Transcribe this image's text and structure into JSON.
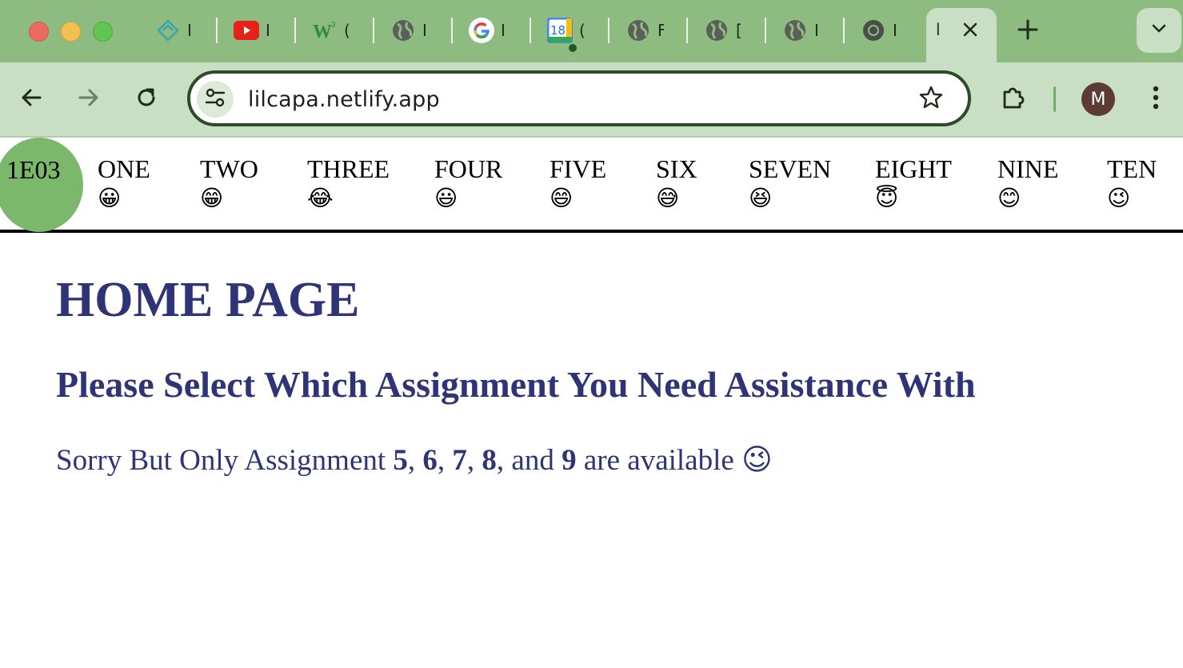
{
  "browser": {
    "tabs": [
      {
        "icon": "netlify-icon",
        "title": "I"
      },
      {
        "icon": "youtube-icon",
        "title": "I"
      },
      {
        "icon": "w3schools-icon",
        "title": "("
      },
      {
        "icon": "globe-icon",
        "title": "I"
      },
      {
        "icon": "google-icon",
        "title": "I"
      },
      {
        "icon": "calendar-icon",
        "title": "(",
        "calendar_day": "18"
      },
      {
        "icon": "globe-icon",
        "title": "F"
      },
      {
        "icon": "globe-icon",
        "title": "["
      },
      {
        "icon": "globe-icon",
        "title": "I"
      },
      {
        "icon": "chrome-icon",
        "title": "I"
      }
    ],
    "active_tab": {
      "title": "l"
    },
    "url": "lilcapa.netlify.app",
    "avatar_initial": "M",
    "colors": {
      "tabstrip": "#8dbb80",
      "toolbar": "#c8dfc4"
    }
  },
  "site": {
    "logo": "1E03",
    "nav": [
      {
        "label": "ONE",
        "emoji": "😀"
      },
      {
        "label": "TWO",
        "emoji": "😁"
      },
      {
        "label": "THREE",
        "emoji": "😂"
      },
      {
        "label": "FOUR",
        "emoji": "😃"
      },
      {
        "label": "FIVE",
        "emoji": "😄"
      },
      {
        "label": "SIX",
        "emoji": "😅"
      },
      {
        "label": "SEVEN",
        "emoji": "😆"
      },
      {
        "label": "EIGHT",
        "emoji": "😇"
      },
      {
        "label": "NINE",
        "emoji": "😊"
      },
      {
        "label": "TEN",
        "emoji": "😉"
      }
    ],
    "title": "HOME PAGE",
    "subtitle": "Please Select Which Assignment You Need Assistance With",
    "notice": {
      "prefix": "Sorry But Only Assignment ",
      "n1": "5",
      "sep1": ", ",
      "n2": "6",
      "sep2": ", ",
      "n3": "7",
      "sep3": ", ",
      "n4": "8",
      "sep4": ", and ",
      "n5": "9",
      "suffix": " are available ",
      "emoji": "😉"
    },
    "colors": {
      "heading": "#2e3476",
      "logo_bg": "#7cb86c"
    }
  }
}
